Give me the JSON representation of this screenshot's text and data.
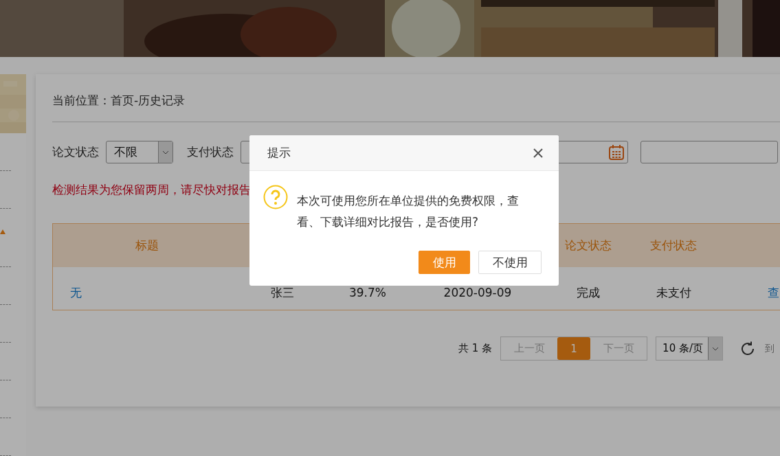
{
  "breadcrumb": "当前位置：首页-历史记录",
  "filters": [
    {
      "kind": "select",
      "label": "论文状态",
      "value": "不限"
    },
    {
      "kind": "select",
      "label": "支付状态"
    },
    {
      "kind": "date"
    },
    {
      "kind": "text"
    }
  ],
  "notice": "检测结果为您保留两周，请尽快对报告",
  "table": {
    "columns": [
      {
        "label": "标题"
      },
      {},
      {},
      {},
      {
        "label": "论文状态"
      },
      {
        "label": "支付状态"
      },
      {}
    ],
    "rows": [
      {
        "cells": [
          "无",
          "张三",
          "39.7%",
          "2020-09-09",
          "完成",
          "未支付",
          "查"
        ]
      }
    ]
  },
  "pagination": {
    "total": "共 1 条",
    "prev": {
      "label": "上一页",
      "disabled": true
    },
    "pages": [
      {
        "label": "1",
        "selected": true
      }
    ],
    "next": {
      "label": "下一页",
      "disabled": true
    },
    "page_size": "10 条/页",
    "goto": "到"
  },
  "dialog": {
    "title": "提示",
    "message": "本次可使用您所在单位提供的免费权限，查看、下载详细对比报告，是否使用?",
    "buttons": [
      {
        "label": "使用",
        "kind": "primary"
      },
      {
        "label": "不使用",
        "kind": "default"
      }
    ]
  }
}
